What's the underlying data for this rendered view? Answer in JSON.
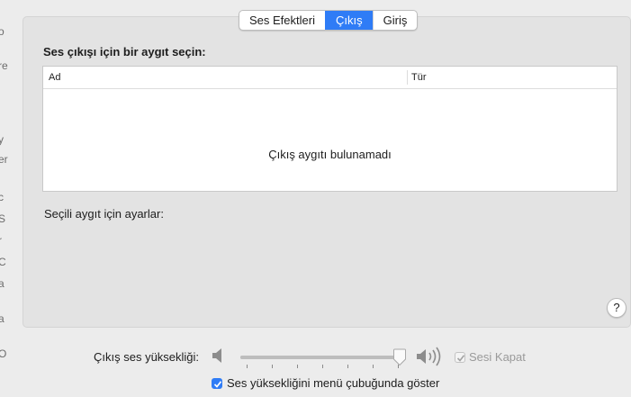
{
  "tabs": [
    {
      "label": "Ses Efektleri",
      "active": false
    },
    {
      "label": "Çıkış",
      "active": true
    },
    {
      "label": "Giriş",
      "active": false
    }
  ],
  "output": {
    "section_title": "Ses çıkışı için bir aygıt seçin:",
    "columns": [
      "Ad",
      "Tür"
    ],
    "empty_message": "Çıkış aygıtı bulunamadı",
    "settings_label": "Seçili aygıt için ayarlar:"
  },
  "help": {
    "label": "?"
  },
  "volume": {
    "label": "Çıkış ses yüksekliği:",
    "level": 0.97,
    "mute_label": "Sesi Kapat",
    "mute_checked": true,
    "mute_enabled": false
  },
  "menubar_option": {
    "label": "Ses yüksekliğini menü çubuğunda göster",
    "checked": true
  },
  "edge_fragments": [
    "o",
    "re",
    "l",
    "y",
    "er",
    "c",
    "S",
    "r",
    "C",
    "a",
    "a",
    "O",
    "l"
  ],
  "colors": {
    "accent": "#2f7cf6",
    "panel": "#e3e3e3",
    "window": "#ececec"
  }
}
